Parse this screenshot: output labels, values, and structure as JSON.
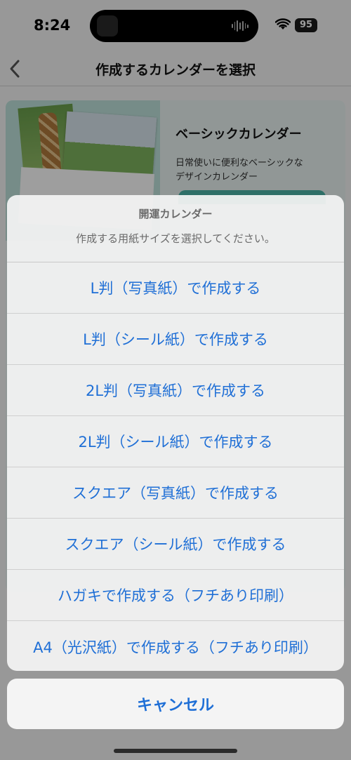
{
  "status": {
    "time": "8:24",
    "battery": "95"
  },
  "nav": {
    "title": "作成するカレンダーを選択"
  },
  "card": {
    "title": "ベーシックカレンダー",
    "description_line1": "日常使いに便利なベーシックな",
    "description_line2": "デザインカレンダー"
  },
  "sheet": {
    "title": "開運カレンダー",
    "message": "作成する用紙サイズを選択してください。",
    "options": [
      "L判（写真紙）で作成する",
      "L判（シール紙）で作成する",
      "2L判（写真紙）で作成する",
      "2L判（シール紙）で作成する",
      "スクエア（写真紙）で作成する",
      "スクエア（シール紙）で作成する",
      "ハガキで作成する（フチあり印刷）",
      "A4（光沢紙）で作成する（フチあり印刷）"
    ],
    "cancel": "キャンセル"
  },
  "colors": {
    "accent": "#1f6fd6",
    "teal": "#4bb3a6"
  }
}
